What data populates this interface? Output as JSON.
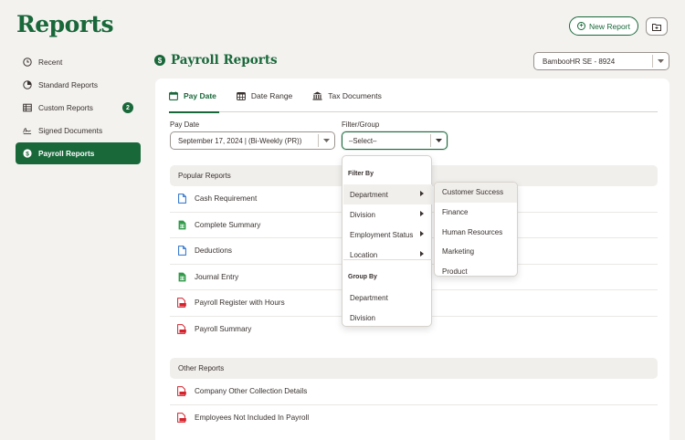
{
  "app": {
    "title": "Reports"
  },
  "header": {
    "new_report_label": "New Report"
  },
  "sidebar": {
    "items": [
      {
        "label": "Recent"
      },
      {
        "label": "Standard Reports"
      },
      {
        "label": "Custom Reports",
        "badge": "2"
      },
      {
        "label": "Signed Documents"
      },
      {
        "label": "Payroll Reports",
        "active": true
      }
    ]
  },
  "section": {
    "title": "Payroll Reports",
    "icon": "$"
  },
  "company_select": {
    "value": "BambooHR SE - 8924"
  },
  "tabs": [
    {
      "label": "Pay Date",
      "active": true
    },
    {
      "label": "Date Range"
    },
    {
      "label": "Tax Documents"
    }
  ],
  "filters": {
    "pay_date_label": "Pay Date",
    "pay_date_value": "September 17, 2024 | (Bi-Weekly (PR))",
    "filter_group_label": "Filter/Group",
    "filter_group_value": "–Select–"
  },
  "popular_reports": {
    "heading": "Popular Reports",
    "items": [
      {
        "label": "Cash Requirement",
        "icon": "doc-blue"
      },
      {
        "label": "Complete Summary",
        "icon": "sheet-green"
      },
      {
        "label": "Deductions",
        "icon": "doc-blue"
      },
      {
        "label": "Journal Entry",
        "icon": "sheet-green"
      },
      {
        "label": "Payroll Register with Hours",
        "icon": "pdf-red"
      },
      {
        "label": "Payroll Summary",
        "icon": "pdf-red"
      }
    ]
  },
  "other_reports": {
    "heading": "Other Reports",
    "items": [
      {
        "label": "Company Other Collection Details",
        "icon": "pdf-red"
      },
      {
        "label": "Employees Not Included In Payroll",
        "icon": "pdf-red"
      }
    ]
  },
  "filter_dropdown": {
    "filter_by_heading": "Filter By",
    "filter_by": [
      "Department",
      "Division",
      "Employment Status",
      "Location"
    ],
    "group_by_heading": "Group By",
    "group_by": [
      "Department",
      "Division"
    ]
  },
  "department_submenu": {
    "items": [
      "Customer Success",
      "Finance",
      "Human Resources",
      "Marketing",
      "Product"
    ]
  },
  "colors": {
    "brand": "#19683a",
    "pdf": "#d4232d",
    "doc": "#2a6fc9",
    "sheet": "#2f9a48"
  }
}
